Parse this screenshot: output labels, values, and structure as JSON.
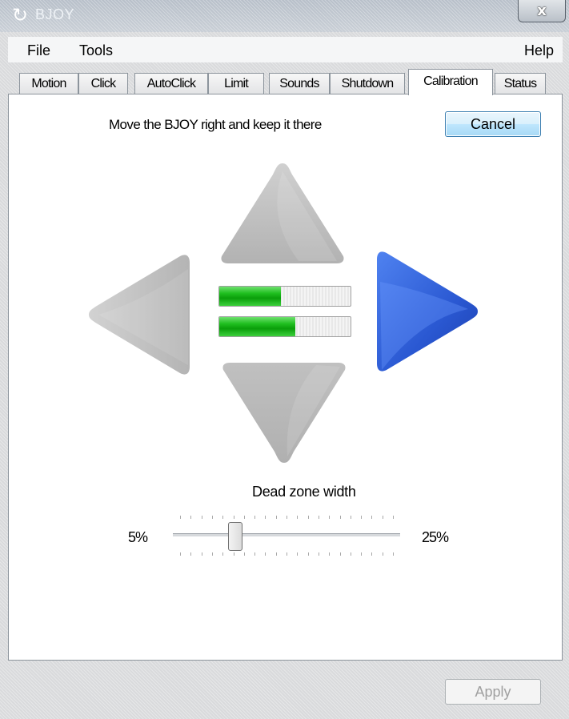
{
  "window": {
    "title": "BJOY",
    "icon": "bjoy-app-icon",
    "close_glyph": "x"
  },
  "menu": {
    "file": "File",
    "tools": "Tools",
    "help": "Help"
  },
  "tabs": [
    {
      "label": "Motion",
      "active": false
    },
    {
      "label": "Click",
      "active": false
    },
    {
      "label": "AutoClick",
      "active": false
    },
    {
      "label": "Limit",
      "active": false
    },
    {
      "label": "Sounds",
      "active": false
    },
    {
      "label": "Shutdown",
      "active": false
    },
    {
      "label": "Calibration",
      "active": true
    },
    {
      "label": "Status",
      "active": false
    }
  ],
  "calibration": {
    "instruction": "Move the BJOY right and keep it there",
    "cancel_label": "Cancel",
    "active_direction": "right",
    "bar_x_level": 0.47,
    "bar_y_level": 0.58,
    "colors": {
      "active_arrow": "#2f5ed8",
      "inactive_arrow": "#bdbdbd",
      "bar_fill": "#16b016"
    }
  },
  "deadzone": {
    "label": "Dead zone width",
    "min_label": "5%",
    "max_label": "25%",
    "value_fraction": 0.26
  },
  "footer": {
    "apply_label": "Apply",
    "apply_enabled": false
  }
}
